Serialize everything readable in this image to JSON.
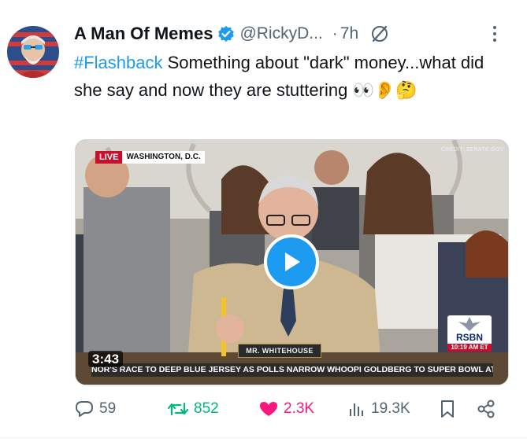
{
  "author": {
    "name": "A Man Of Memes",
    "handle": "@RickyD...",
    "separator": "·",
    "time": "7h",
    "avatar_icon": "avatar-image",
    "verified_color": "#1d9bf0"
  },
  "tweet": {
    "hashtag": "#Flashback",
    "text": " Something about \"dark\" money...what did she say and now they are stuttering ",
    "emojis": "👀👂🤔"
  },
  "media": {
    "duration": "3:43",
    "live_label": "LIVE",
    "location": "WASHINGTON, D.C.",
    "credit": "CREDIT: SENATE.GOV",
    "nameplate": "MR. WHITEHOUSE",
    "ticker": "NOR'S RACE TO DEEP BLUE JERSEY AS POLLS NARROW   WHOOPI GOLDBERG TO SUPER BOWL AT",
    "network": "RSBN",
    "network_time": "10:19 AM ET",
    "play_icon": "play-icon"
  },
  "actions": {
    "replies": "59",
    "reposts": "852",
    "likes": "2.3K",
    "views": "19.3K"
  },
  "colors": {
    "accent": "#1d9bf0",
    "repost": "#00ba7c",
    "like": "#f91880",
    "muted": "#536471"
  }
}
